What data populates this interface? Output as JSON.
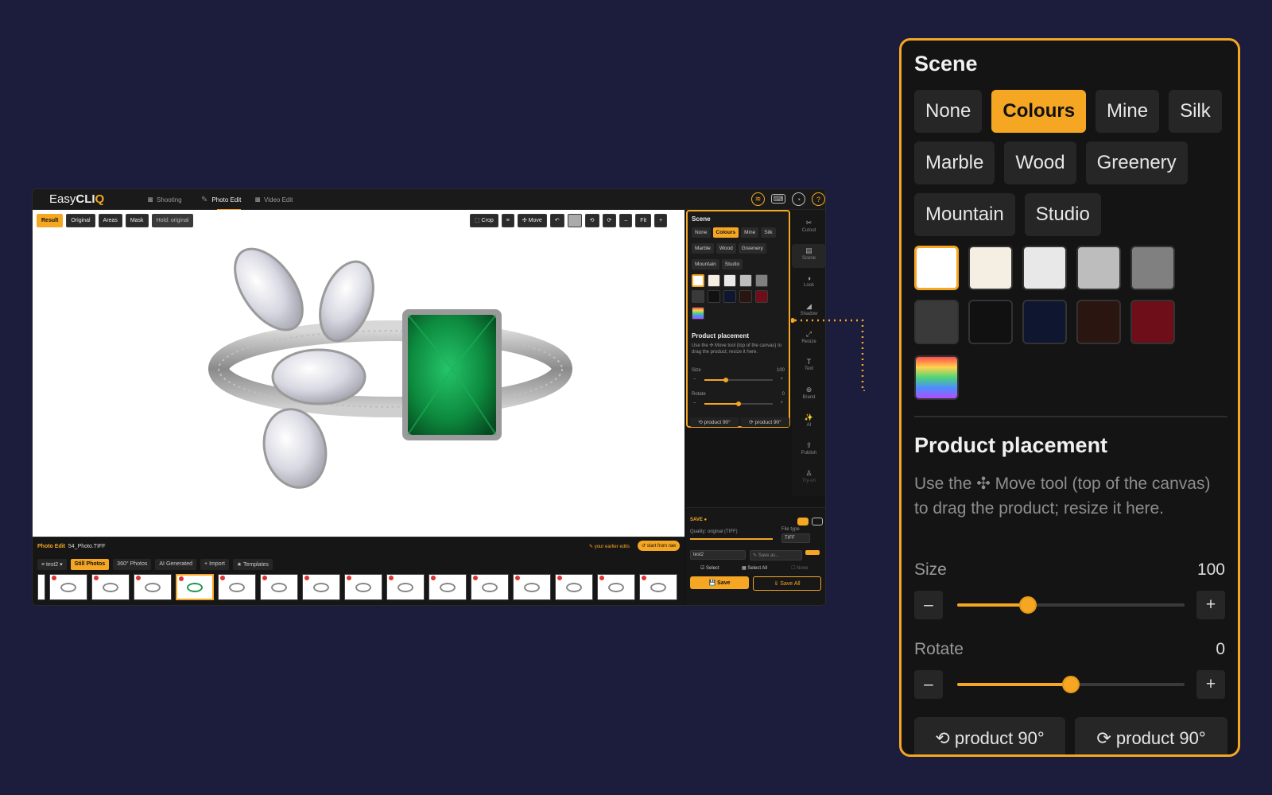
{
  "app": {
    "logo": {
      "easy": "Easy",
      "cli": "CLI",
      "q": "Q"
    },
    "nav": [
      {
        "label": "Shooting",
        "icon": "camera-icon"
      },
      {
        "label": "Photo Edit",
        "icon": "edit-icon"
      },
      {
        "label": "Video Edit",
        "icon": "video-icon"
      }
    ],
    "active_nav": "Photo Edit",
    "top_icons": [
      "wifi-icon",
      "keyboard-icon",
      "user-icon",
      "help-icon"
    ],
    "top_icon_glyphs": {
      "wifi": "≋",
      "keyboard": "⌨",
      "user": "◔",
      "help": "?"
    }
  },
  "canvas_toolbar": {
    "left": [
      "Result",
      "Original",
      "Areas",
      "Mask"
    ],
    "active": "Result",
    "hint": "Hold: original",
    "right": {
      "crop": "⬚ Crop",
      "move": "✣ Move",
      "fit": "Fit",
      "minus": "–",
      "plus": "+",
      "grid": "≡",
      "undo": "↶",
      "rot_l": "⟲",
      "rot_r": "⟳"
    }
  },
  "bottom": {
    "title": "Photo Edit",
    "filename": "54_Photo.TIFF",
    "earlier_edits": "✎ your earlier edits",
    "start_raw": "↺ start from raw",
    "session": "≡ test2 ▾",
    "tabs": [
      "Still Photos",
      "360° Photos",
      "AI Generated",
      "+ Import",
      "★ Templates"
    ],
    "active_tab": "Still Photos",
    "thumbnail_count": 16,
    "selected_thumbnail": 4
  },
  "scene": {
    "heading": "Scene",
    "options_row1": [
      "None",
      "Colours",
      "Mine",
      "Silk"
    ],
    "options_row2": [
      "Marble",
      "Wood",
      "Greenery"
    ],
    "options_row3": [
      "Mountain",
      "Studio"
    ],
    "active": "Colours",
    "swatches_row1": [
      "#ffffff",
      "#f4efe2",
      "#e8e8e8",
      "#bdbdbd",
      "#808080"
    ],
    "swatches_row2": [
      "#3a3a3a",
      "#111111",
      "#0f1630",
      "#2a1510",
      "#6e0e18"
    ],
    "selected_swatch": "#ffffff"
  },
  "placement": {
    "heading": "Product placement",
    "description": "Use the ✣ Move tool (top of the canvas) to drag the product; resize it here.",
    "size_label": "Size",
    "size_value": "100",
    "size_fraction": 0.31,
    "rotate_label": "Rotate",
    "rotate_value": "0",
    "rotate_fraction": 0.5,
    "minus": "–",
    "plus": "+",
    "rotate_left": "⟲ product 90°",
    "rotate_right": "⟳ product 90°"
  },
  "rail": [
    {
      "label": "Cutout",
      "icon": "✂"
    },
    {
      "label": "Scene",
      "icon": "▤"
    },
    {
      "label": "Look",
      "icon": "◑"
    },
    {
      "label": "Shadow",
      "icon": "◢"
    },
    {
      "label": "Resize",
      "icon": "⤢"
    },
    {
      "label": "Text",
      "icon": "T"
    },
    {
      "label": "Brand",
      "icon": "⊛"
    },
    {
      "label": "AI",
      "icon": "✨"
    },
    {
      "label": "Publish",
      "icon": "⇪"
    },
    {
      "label": "Try-on",
      "icon": "♙"
    }
  ],
  "save_panel": {
    "title": "SAVE ●",
    "quality_label": "Quality: original (TIFF)",
    "file_type_label": "File type",
    "file_type": "TIFF",
    "folder": "test2",
    "save_as": "✎ Save as...",
    "select": "☑ Select",
    "select_all": "▦ Select All",
    "none": "☐ None",
    "save": "💾 Save",
    "save_all": "⇓ Save All"
  },
  "colors": {
    "accent": "#f5a623",
    "background": "#1c1d3c",
    "panel": "#141414"
  }
}
